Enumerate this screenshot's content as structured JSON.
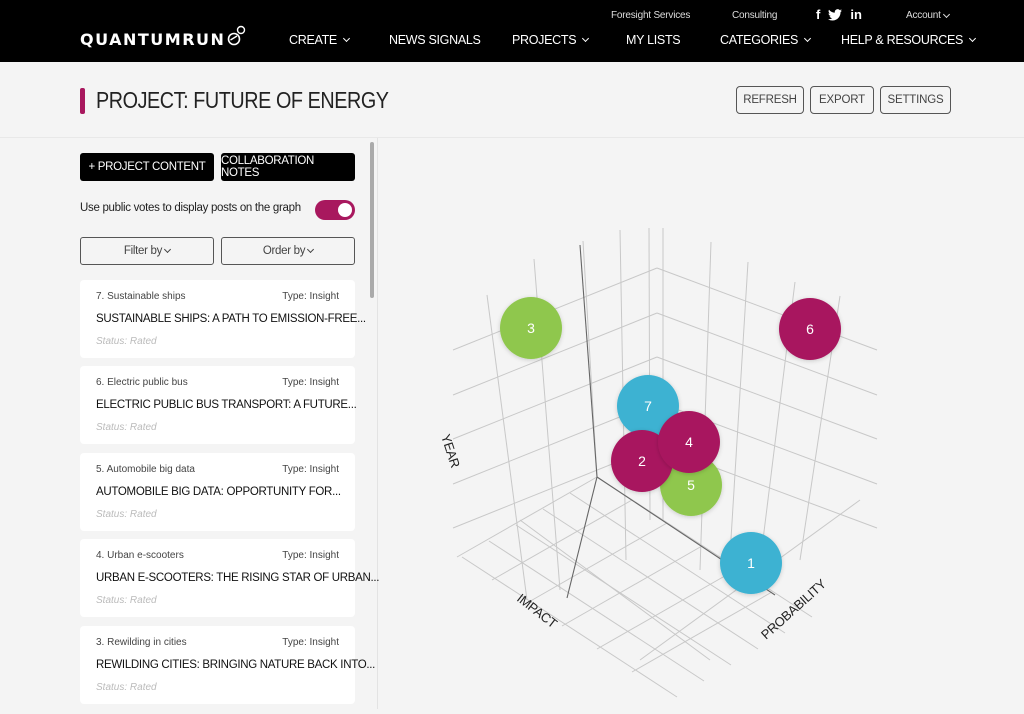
{
  "brand": {
    "logo_text": "QUANTUMRUN",
    "accent": "#a8185e"
  },
  "utility_nav": {
    "foresight": "Foresight Services",
    "consulting": "Consulting",
    "social": [
      "facebook-icon",
      "twitter-icon",
      "linkedin-icon"
    ],
    "social_glyphs": [
      "f",
      "🐦",
      "in"
    ],
    "account": "Account"
  },
  "main_nav": {
    "create": "CREATE",
    "news_signals": "NEWS SIGNALS",
    "projects": "PROJECTS",
    "my_lists": "MY LISTS",
    "categories": "CATEGORIES",
    "help": "HELP & RESOURCES"
  },
  "header": {
    "title": "PROJECT: FUTURE OF ENERGY",
    "refresh": "REFRESH",
    "export": "EXPORT",
    "settings": "SETTINGS"
  },
  "sidebar": {
    "project_content": "+ PROJECT CONTENT",
    "collab_notes": "COLLABORATION NOTES",
    "toggle_label": "Use public votes to display posts on the graph",
    "toggle_on": true,
    "filter_by": "Filter by",
    "order_by": "Order by",
    "cards": [
      {
        "num": "7. Sustainable ships",
        "type": "Type: Insight",
        "headline": "SUSTAINABLE SHIPS: A PATH TO EMISSION-FREE...",
        "status": "Status: Rated"
      },
      {
        "num": "6. Electric public bus",
        "type": "Type: Insight",
        "headline": "ELECTRIC PUBLIC BUS TRANSPORT: A FUTURE...",
        "status": "Status: Rated"
      },
      {
        "num": "5. Automobile big data",
        "type": "Type: Insight",
        "headline": "AUTOMOBILE BIG DATA: OPPORTUNITY FOR...",
        "status": "Status: Rated"
      },
      {
        "num": "4. Urban e-scooters",
        "type": "Type: Insight",
        "headline": "URBAN E-SCOOTERS: THE RISING STAR OF URBAN...",
        "status": "Status: Rated"
      },
      {
        "num": "3. Rewilding in cities",
        "type": "Type: Insight",
        "headline": "REWILDING CITIES: BRINGING NATURE BACK INTO...",
        "status": "Status: Rated"
      }
    ]
  },
  "graph": {
    "axes": {
      "year": "YEAR",
      "impact": "IMPACT",
      "probability": "PROBABILITY"
    },
    "colors": {
      "green": "#8fc74e",
      "magenta": "#a8185e",
      "blue": "#3cb2d2"
    },
    "bubbles": [
      {
        "label": "3",
        "color": "green"
      },
      {
        "label": "6",
        "color": "magenta"
      },
      {
        "label": "7",
        "color": "blue"
      },
      {
        "label": "5",
        "color": "green"
      },
      {
        "label": "2",
        "color": "magenta"
      },
      {
        "label": "4",
        "color": "magenta"
      },
      {
        "label": "1",
        "color": "blue"
      }
    ]
  }
}
